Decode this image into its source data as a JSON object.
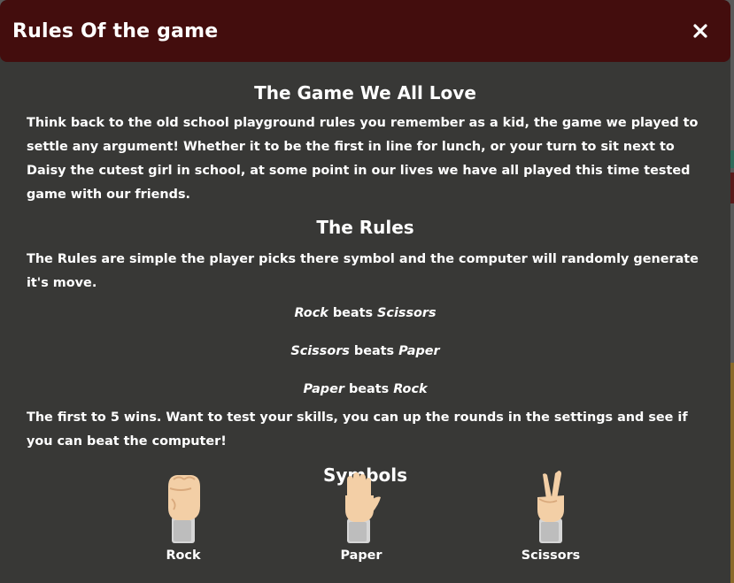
{
  "modal": {
    "title": "Rules Of the game",
    "close_icon": "close-icon"
  },
  "intro": {
    "heading": "The Game We All Love",
    "text": "Think back to the old school playground rules you remember as a kid, the game we played to settle any argument! Whether it to be the first in line for lunch, or your turn to sit next to Daisy the cutest girl in school, at some point in our lives we have all played this time tested game with our friends."
  },
  "rules": {
    "heading": "The Rules",
    "text": "The Rules are simple the player picks there symbol and the computer will randomly generate it's move.",
    "lines": [
      {
        "winner": "Rock",
        "verb": "beats",
        "loser": "Scissors"
      },
      {
        "winner": "Scissors",
        "verb": "beats",
        "loser": "Paper"
      },
      {
        "winner": "Paper",
        "verb": "beats",
        "loser": "Rock"
      }
    ],
    "closing": "The first to 5 wins. Want to test your skills, you can up the rounds in the settings and see if you can beat the computer!"
  },
  "symbols": {
    "heading": "Symbols",
    "items": [
      {
        "label": "Rock",
        "icon": "fist-icon"
      },
      {
        "label": "Paper",
        "icon": "open-hand-icon"
      },
      {
        "label": "Scissors",
        "icon": "peace-hand-icon"
      }
    ]
  },
  "colors": {
    "header": "#430d0d",
    "panel": "#383836",
    "text": "#ffffff",
    "skin": "#f3cfa6",
    "sleeve": "#d8d8d8"
  }
}
